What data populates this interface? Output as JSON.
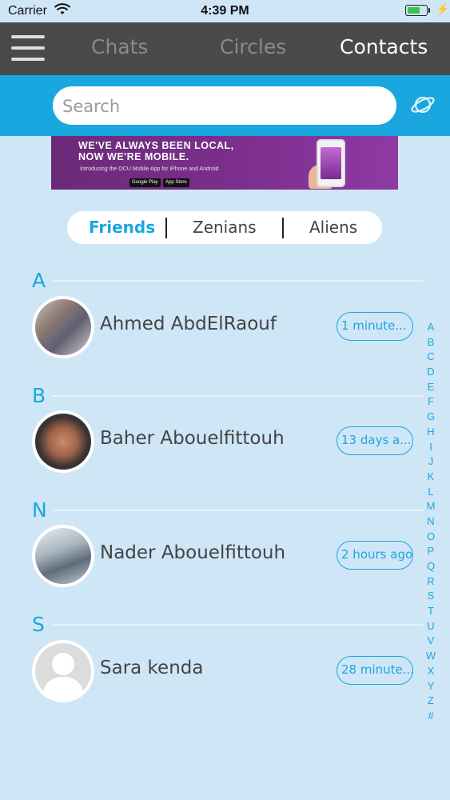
{
  "status_bar": {
    "carrier": "Carrier",
    "time": "4:39 PM",
    "battery_level": 0.7
  },
  "nav": {
    "tabs": [
      {
        "label": "Chats",
        "active": false
      },
      {
        "label": "Circles",
        "active": false
      },
      {
        "label": "Contacts",
        "active": true
      }
    ]
  },
  "search": {
    "placeholder": "Search",
    "value": ""
  },
  "ad": {
    "line1": "WE'VE ALWAYS BEEN LOCAL,",
    "line2": "NOW WE'RE MOBILE.",
    "sub": "Introducing the OCU Mobile App for iPhone and Android",
    "badge1": "Google Play",
    "badge2": "App Store"
  },
  "segments": {
    "items": [
      {
        "label": "Friends",
        "active": true
      },
      {
        "label": "Zenians",
        "active": false
      },
      {
        "label": "Aliens",
        "active": false
      }
    ]
  },
  "sections": [
    {
      "letter": "A",
      "contact": {
        "name": "Ahmed AbdElRaouf",
        "last_seen": "1 minute..."
      }
    },
    {
      "letter": "B",
      "contact": {
        "name": "Baher Abouelfittouh",
        "last_seen": "13 days a..."
      }
    },
    {
      "letter": "N",
      "contact": {
        "name": "Nader Abouelfittouh",
        "last_seen": "2 hours ago"
      }
    },
    {
      "letter": "S",
      "contact": {
        "name": "Sara kenda",
        "last_seen": "28 minute..."
      }
    }
  ],
  "index_letters": [
    "A",
    "B",
    "C",
    "D",
    "E",
    "F",
    "G",
    "H",
    "I",
    "J",
    "K",
    "L",
    "M",
    "N",
    "O",
    "P",
    "Q",
    "R",
    "S",
    "T",
    "U",
    "V",
    "W",
    "X",
    "Y",
    "Z",
    "#"
  ],
  "colors": {
    "accent": "#1aa6df",
    "nav_bg": "#4a4a4a",
    "page_bg": "#cfe6f7"
  }
}
